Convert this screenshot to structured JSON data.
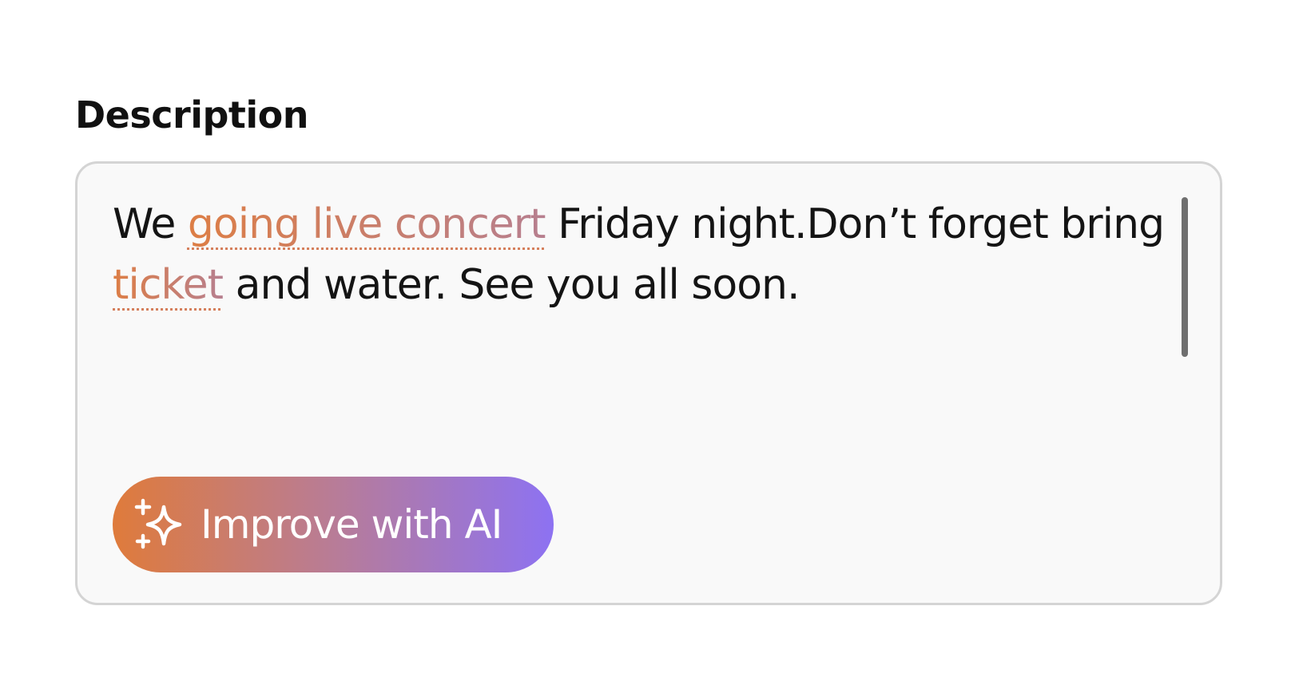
{
  "field": {
    "label": "Description"
  },
  "description": {
    "segments": [
      {
        "text": "We ",
        "flagged": false
      },
      {
        "text": "going live concert",
        "flagged": true
      },
      {
        "text": " Friday night.Don’t forget bring ",
        "flagged": false
      },
      {
        "text": "ticket",
        "flagged": true
      },
      {
        "text": " and water. See you all soon.",
        "flagged": false
      }
    ]
  },
  "ai_button": {
    "label": "Improve with AI",
    "icon": "sparkle-icon"
  },
  "colors": {
    "gradient_start": "#df7b3b",
    "gradient_mid": "#b87c97",
    "gradient_end": "#8d72f2",
    "flag_underline": "#d57f5c",
    "box_border": "#d4d4d4",
    "box_background": "#f9f9f9"
  }
}
